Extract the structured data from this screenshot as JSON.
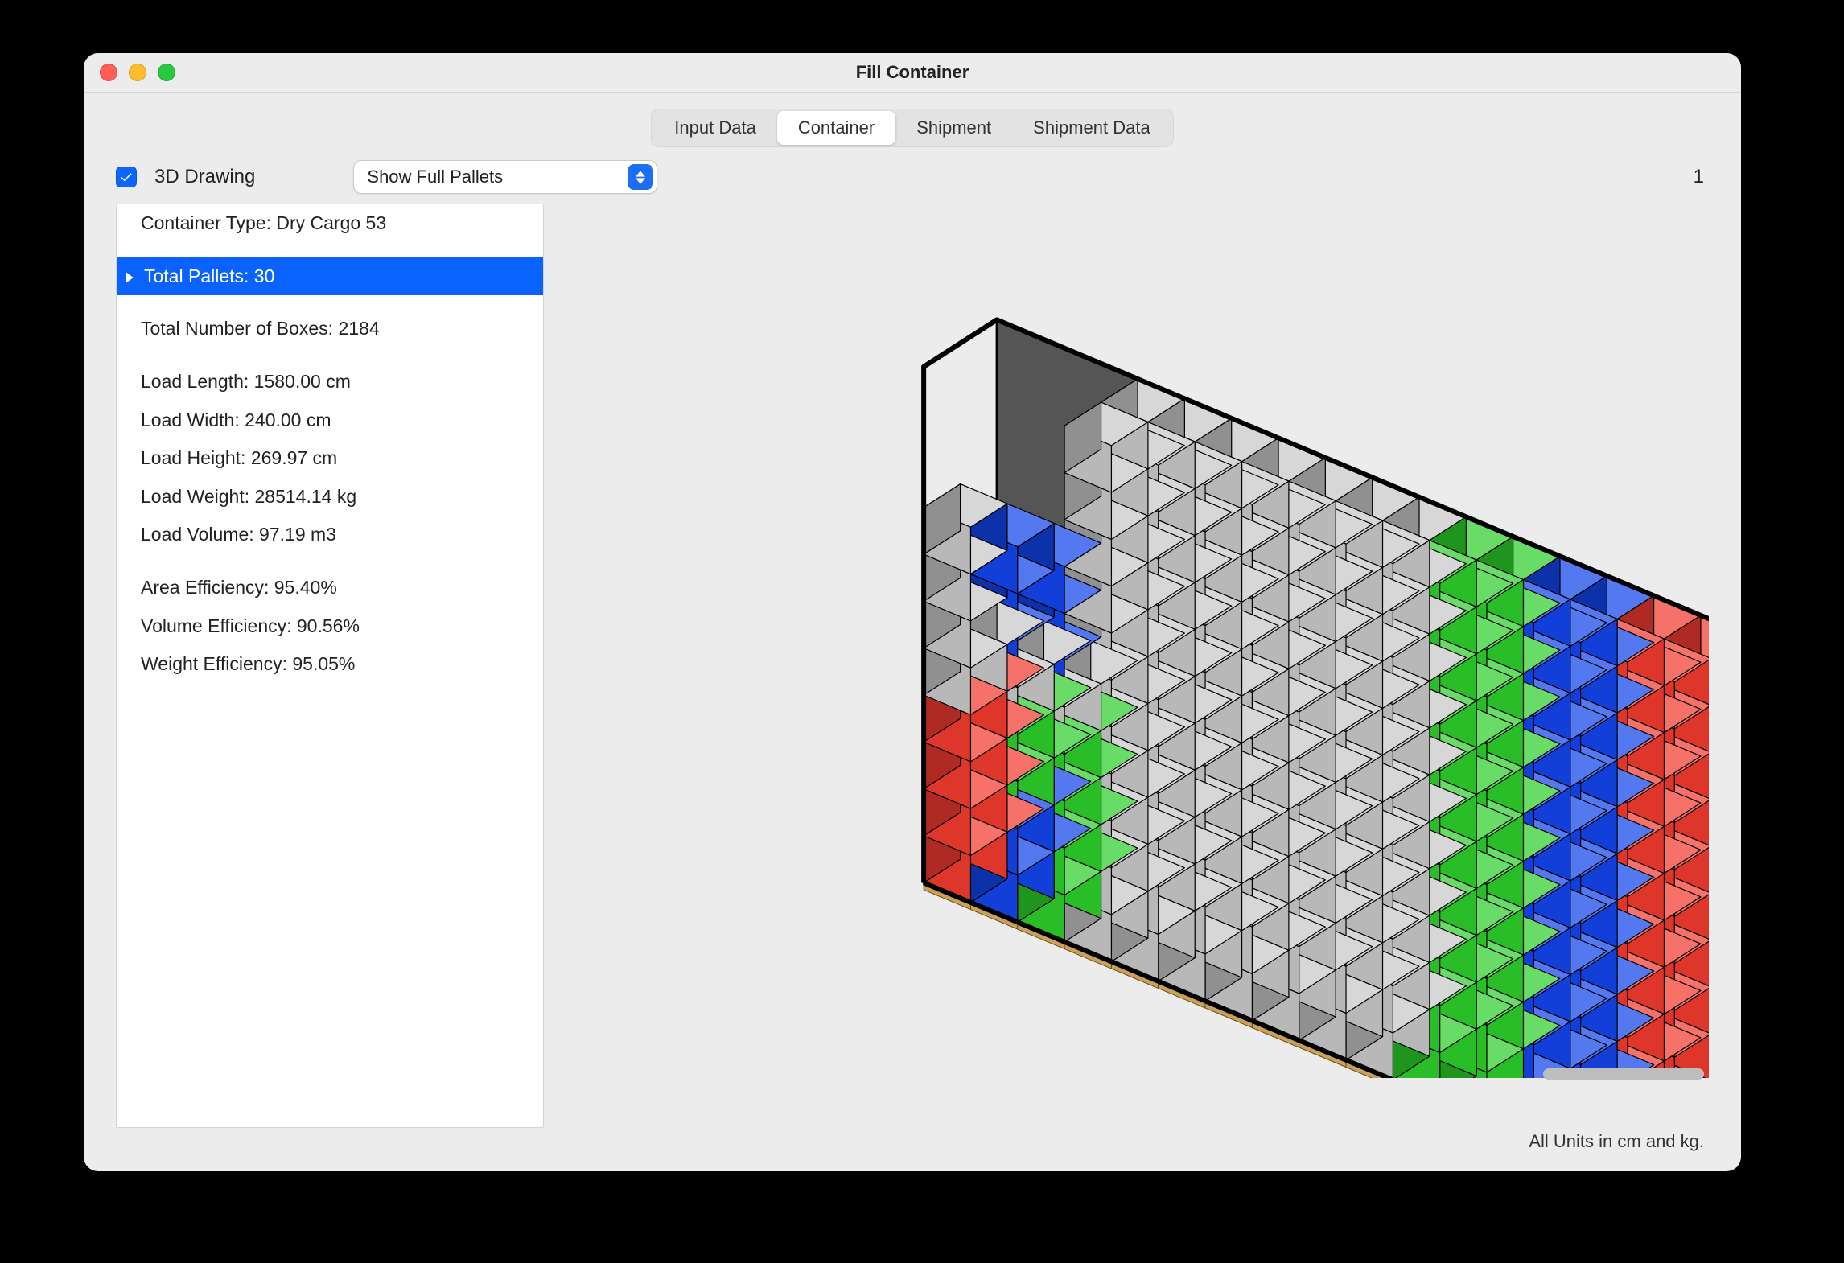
{
  "window": {
    "title": "Fill Container"
  },
  "tabs": {
    "items": [
      "Input Data",
      "Container",
      "Shipment",
      "Shipment Data"
    ],
    "active_index": 1
  },
  "controls": {
    "checkbox_label": "3D Drawing",
    "checkbox_checked": true,
    "select_value": "Show Full Pallets",
    "page_number": "1"
  },
  "info_panel": {
    "container_type_label": "Container Type: Dry Cargo 53",
    "total_pallets_label": "Total Pallets: 30",
    "total_boxes_label": "Total Number of Boxes: 2184",
    "load_length_label": "Load Length: 1580.00 cm",
    "load_width_label": "Load Width: 240.00 cm",
    "load_height_label": "Load Height: 269.97 cm",
    "load_weight_label": "Load Weight: 28514.14 kg",
    "load_volume_label": "Load Volume: 97.19 m3",
    "area_eff_label": "Area Efficiency: 95.40%",
    "volume_eff_label": "Volume Efficiency: 90.56%",
    "weight_eff_label": "Weight Efficiency: 95.05%"
  },
  "footer": {
    "units_note": "All Units in cm and kg."
  },
  "colors": {
    "accent": "#0a63ff",
    "pallet_red": "#f23b2f",
    "pallet_green": "#2dcf2a",
    "pallet_blue": "#1244ea",
    "pallet_gray": "#c8c8c8",
    "pallet_gray_light": "#e2e2e2",
    "outline": "#000000"
  },
  "viz": {
    "container_type": "Dry Cargo 53",
    "total_pallets": 30,
    "pallet_colors_legend": [
      "red",
      "green",
      "blue",
      "gray"
    ]
  }
}
